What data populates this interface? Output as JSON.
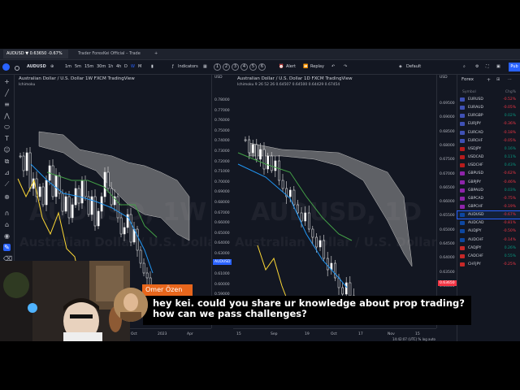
{
  "browser": {
    "tabs": [
      {
        "label": "AUDUSD ▼ 0.63650  -0.67%",
        "active": true
      },
      {
        "label": "Trader ForexKei Official – Trade",
        "active": false
      },
      {
        "label": "+",
        "active": false
      }
    ]
  },
  "toolbar": {
    "symbol": "AUDUSD",
    "intervals": [
      "1m",
      "5m",
      "15m",
      "30m",
      "1h",
      "4h",
      "D",
      "W",
      "M"
    ],
    "indicators_label": "Indicators",
    "layout_numbers": [
      "1",
      "2",
      "3",
      "4",
      "5",
      "6"
    ],
    "alert_label": "Alert",
    "replay_label": "Replay",
    "default_label": "Default",
    "publish_label": "Pub"
  },
  "left_chart": {
    "title": "Australian Dollar / U.S. Dollar  1W  FXCM  TradingView",
    "indicator": "Ichimoku",
    "watermark_symbol": "AUDUSD, 1W",
    "watermark_name": "Australian Dollar / U.S. Dollar",
    "axis_label": "USD",
    "price_ticks": [
      "0.78000",
      "0.77000",
      "0.76000",
      "0.75000",
      "0.74000",
      "0.73000",
      "0.72000",
      "0.71000",
      "0.70000",
      "0.69000",
      "0.68000",
      "0.67000",
      "0.66000",
      "0.65000",
      "0.64000",
      "0.63000",
      "0.62000",
      "0.61000",
      "0.60000",
      "0.59000"
    ],
    "price_tag": "AUDUSD",
    "time_ticks": [
      "Oct",
      "2023",
      "Apr"
    ]
  },
  "right_chart": {
    "title": "Australian Dollar / U.S. Dollar  1D  FXCM  TradingView",
    "indicator": "Ichimoku  9 26 52 26  0.64507  0.64500  0.64429  0.67454",
    "watermark_symbol": "AUDUSD, 1D",
    "watermark_name": "Australian Dollar / U.S. Dollar",
    "axis_label": "USD",
    "price_ticks": [
      "0.69500",
      "0.69000",
      "0.68500",
      "0.68000",
      "0.67500",
      "0.67000",
      "0.66500",
      "0.66000",
      "0.65500",
      "0.65000",
      "0.64500",
      "0.64000",
      "0.63500",
      "0.63000",
      "0.62500"
    ],
    "price_tag": "0.63650",
    "time_ticks": [
      "15",
      "Sep",
      "19",
      "Oct",
      "17",
      "Nov",
      "15"
    ]
  },
  "bottom_status": "14:42:07 (UTC)   %   log   auto",
  "watchlist": {
    "title": "Forex",
    "col_symbol": "Symbol",
    "col_change": "Chg%",
    "rows": [
      {
        "symbol": "EURUSD",
        "change": "-0.52%",
        "dir": "neg",
        "color": "#3f51b5"
      },
      {
        "symbol": "EURAUD",
        "change": "-0.05%",
        "dir": "neg",
        "color": "#3f51b5"
      },
      {
        "symbol": "EURGBP",
        "change": "0.02%",
        "dir": "pos",
        "color": "#3f51b5"
      },
      {
        "symbol": "EURJPY",
        "change": "-0.36%",
        "dir": "neg",
        "color": "#3f51b5"
      },
      {
        "symbol": "EURCAD",
        "change": "-0.18%",
        "dir": "neg",
        "color": "#3f51b5"
      },
      {
        "symbol": "EURCHF",
        "change": "-0.05%",
        "dir": "neg",
        "color": "#3f51b5"
      },
      {
        "symbol": "USDJPY",
        "change": "0.16%",
        "dir": "pos",
        "color": "#b71c1c"
      },
      {
        "symbol": "USDCAD",
        "change": "0.11%",
        "dir": "pos",
        "color": "#b71c1c"
      },
      {
        "symbol": "USDCHF",
        "change": "0.43%",
        "dir": "pos",
        "color": "#b71c1c"
      },
      {
        "symbol": "GBPUSD",
        "change": "-0.62%",
        "dir": "neg",
        "color": "#8e24aa"
      },
      {
        "symbol": "GBPJPY",
        "change": "-0.46%",
        "dir": "neg",
        "color": "#8e24aa"
      },
      {
        "symbol": "GBPAUD",
        "change": "0.03%",
        "dir": "pos",
        "color": "#8e24aa"
      },
      {
        "symbol": "GBPCAD",
        "change": "-0.75%",
        "dir": "neg",
        "color": "#8e24aa"
      },
      {
        "symbol": "GBPCHF",
        "change": "-0.19%",
        "dir": "neg",
        "color": "#8e24aa"
      },
      {
        "symbol": "AUDUSD",
        "change": "-0.67%",
        "dir": "neg",
        "color": "#0d47a1",
        "selected": true
      },
      {
        "symbol": "AUDCAD",
        "change": "-0.81%",
        "dir": "neg",
        "color": "#0d47a1"
      },
      {
        "symbol": "AUDJPY",
        "change": "-0.50%",
        "dir": "neg",
        "color": "#0d47a1"
      },
      {
        "symbol": "AUDCHF",
        "change": "-0.14%",
        "dir": "neg",
        "color": "#0d47a1"
      },
      {
        "symbol": "CADJPY",
        "change": "0.26%",
        "dir": "pos",
        "color": "#c62828"
      },
      {
        "symbol": "CADCHF",
        "change": "0.55%",
        "dir": "pos",
        "color": "#c62828"
      },
      {
        "symbol": "CHFJPY",
        "change": "-0.25%",
        "dir": "neg",
        "color": "#c62828"
      }
    ]
  },
  "chat": {
    "username": "Omer Özen",
    "message": "hey kei. could you share ur knowledge about prop trading? how can we pass challenges?"
  },
  "colors": {
    "background": "#131722",
    "accent": "#2962ff",
    "up": "#089981",
    "down": "#f23645",
    "cloud": "#9e9e9e",
    "kijun": "#43a047",
    "tenkan": "#2196f3",
    "chikou": "#fdd835",
    "chat_name_bg": "#e8661c"
  }
}
